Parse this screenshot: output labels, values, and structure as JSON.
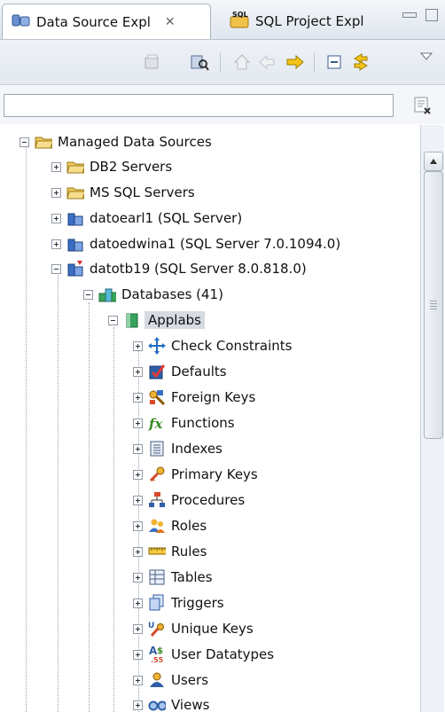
{
  "tabs": [
    {
      "label": "Data Source Expl",
      "close": "✕",
      "icon": "data-source-explorer-icon"
    },
    {
      "label": "SQL Project Expl",
      "icon": "sql-project-icon",
      "icon_text": "SQL"
    }
  ],
  "toolbar": {
    "icons": [
      "collapse-all-icon",
      "filter-properties-icon",
      "home-icon",
      "back-arrow-icon",
      "forward-arrow-icon",
      "collapse-icon",
      "link-editor-icon",
      "view-menu-icon"
    ]
  },
  "filter": {
    "value": "",
    "placeholder": ""
  },
  "tree": {
    "root": {
      "label": "Managed Data Sources"
    },
    "servers": [
      {
        "label": "DB2 Servers"
      },
      {
        "label": "MS SQL Servers"
      },
      {
        "label": "datoearl1 (SQL Server)"
      },
      {
        "label": "datoedwina1 (SQL Server 7.0.1094.0)"
      },
      {
        "label": "datotb19 (SQL Server 8.0.818.0)"
      }
    ],
    "databases": {
      "label": "Databases (41)"
    },
    "selected_db": {
      "label": "Applabs"
    },
    "objects": [
      {
        "label": "Check Constraints"
      },
      {
        "label": "Defaults"
      },
      {
        "label": "Foreign Keys"
      },
      {
        "label": "Functions"
      },
      {
        "label": "Indexes"
      },
      {
        "label": "Primary Keys"
      },
      {
        "label": "Procedures"
      },
      {
        "label": "Roles"
      },
      {
        "label": "Rules"
      },
      {
        "label": "Tables"
      },
      {
        "label": "Triggers"
      },
      {
        "label": "Unique Keys"
      },
      {
        "label": "User Datatypes"
      },
      {
        "label": "Users"
      },
      {
        "label": "Views"
      }
    ]
  },
  "colors": {
    "accent": "#f5c518",
    "tab_border": "#a8b4c2",
    "selection": "#d6dbe2"
  }
}
